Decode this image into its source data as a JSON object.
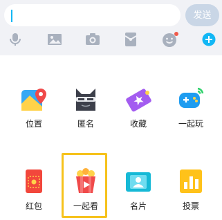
{
  "input": {
    "value": "",
    "send_label": "发送"
  },
  "toolbar": {
    "icons": [
      "microphone-icon",
      "image-icon",
      "camera-icon",
      "red-packet-icon",
      "emoji-icon",
      "plus-icon"
    ],
    "emoji_badge_color": "#f05a4a",
    "plus_color": "#12b7f5"
  },
  "grid": {
    "items": [
      {
        "label": "位置"
      },
      {
        "label": "匿名"
      },
      {
        "label": "收藏"
      },
      {
        "label": "一起玩"
      },
      {
        "label": "红包"
      },
      {
        "label": "一起看"
      },
      {
        "label": "名片"
      },
      {
        "label": "投票"
      }
    ],
    "selected_index": 5
  },
  "colors": {
    "accent": "#12b7f5",
    "selection": "#f6c21c"
  }
}
